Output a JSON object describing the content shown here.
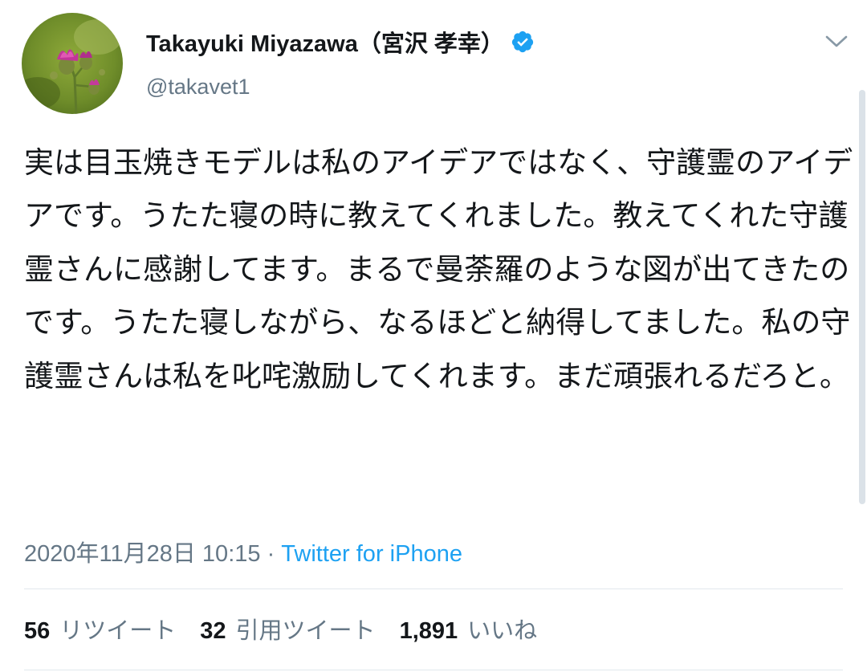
{
  "tweet": {
    "author": {
      "display_name": "Takayuki Miyazawa（宮沢 孝幸）",
      "handle": "@takavet1",
      "verified": true,
      "avatar_icon": "thistle-flower-avatar"
    },
    "menu_icon": "chevron-down-icon",
    "text": "実は目玉焼きモデルは私のアイデアではなく、守護霊のアイデアです。うたた寝の時に教えてくれました。教えてくれた守護霊さんに感謝してます。まるで曼荼羅のような図が出てきたのです。うたた寝しながら、なるほどと納得してました。私の守護霊さんは私を叱咤激励してくれます。まだ頑張れるだろと。",
    "timestamp": "2020年11月28日 10:15",
    "separator": " · ",
    "source": "Twitter for iPhone",
    "stats": [
      {
        "count": "56",
        "label": "リツイート"
      },
      {
        "count": "32",
        "label": "引用ツイート"
      },
      {
        "count": "1,891",
        "label": "いいね"
      }
    ]
  },
  "colors": {
    "text_primary": "#14171a",
    "text_secondary": "#657786",
    "link": "#1da1f2",
    "verified": "#1da1f2",
    "divider": "#e1e8ed"
  }
}
